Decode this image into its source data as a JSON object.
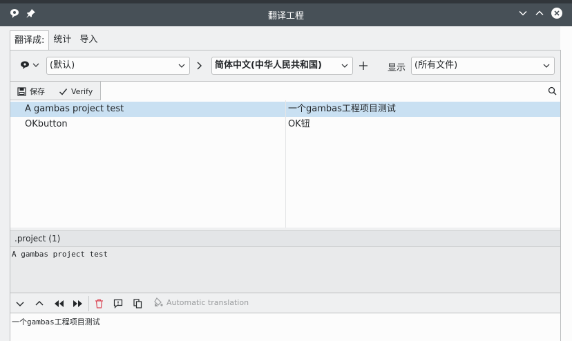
{
  "window": {
    "title": "翻译工程"
  },
  "tabs": [
    {
      "label": "翻译成:"
    },
    {
      "label": "统计"
    },
    {
      "label": "导入"
    }
  ],
  "langbar": {
    "source_language": "(默认)",
    "target_language": "简体中文(中华人民共和国)",
    "show_label": "显示",
    "filter_value": "(所有文件)"
  },
  "toolbar": {
    "save_label": "保存",
    "verify_label": "Verify"
  },
  "translations": [
    {
      "source": "A gambas project test",
      "target": "一个gambas工程项目测试",
      "selected": true
    },
    {
      "source": "OKbutton",
      "target": "OK钮",
      "selected": false
    }
  ],
  "source_panel": {
    "header": ".project (1)",
    "text": "A gambas project test"
  },
  "edit_toolbar": {
    "auto_translation_label": "Automatic translation"
  },
  "translation_panel": {
    "text": "一个gambas工程项目测试"
  },
  "colors": {
    "titlebar": "#475057",
    "selection": "#c9e0f2",
    "delete_red": "#da4453"
  }
}
